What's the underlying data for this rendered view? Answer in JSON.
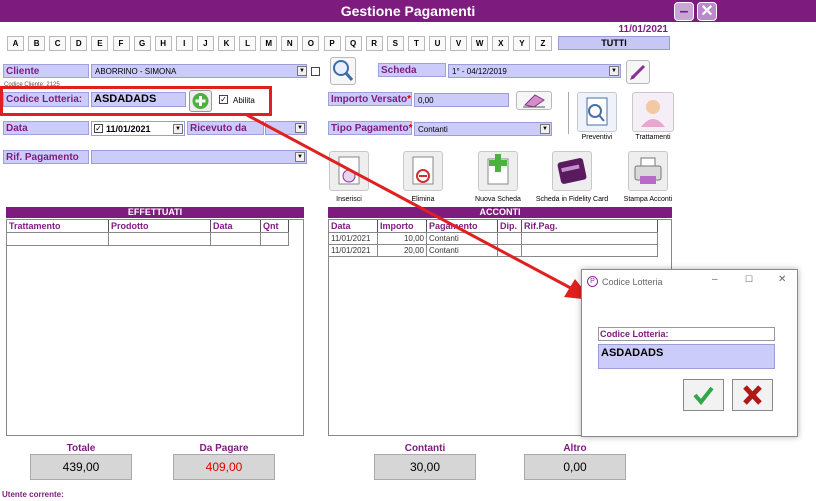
{
  "window": {
    "title": "Gestione Pagamenti",
    "date": "11/01/2021"
  },
  "alphabet": [
    "A",
    "B",
    "C",
    "D",
    "E",
    "F",
    "G",
    "H",
    "I",
    "J",
    "K",
    "L",
    "M",
    "N",
    "O",
    "P",
    "Q",
    "R",
    "S",
    "T",
    "U",
    "V",
    "W",
    "X",
    "Y",
    "Z"
  ],
  "tutti_label": "TUTTI",
  "form": {
    "cliente_label": "Cliente",
    "cliente_value": "ABORRINO - SIMONA",
    "codice_cliente": "Codice Cliente: 2125",
    "scheda_label": "Scheda",
    "scheda_value": "1° - 04/12/2019",
    "lotteria_label": "Codice Lotteria:",
    "lotteria_value": "ASDADADS",
    "abilita_label": "Abilita",
    "importo_label": "Importo Versato",
    "importo_value": "0,00",
    "data_label": "Data",
    "data_value": "11/01/2021",
    "ricevuto_label": "Ricevuto da",
    "tipo_label": "Tipo Pagamento",
    "tipo_value": "Contanti",
    "rif_label": "Rif. Pagamento",
    "required_mark": "*"
  },
  "side_buttons": {
    "preventivi": "Preventivi",
    "trattamenti": "Trattamenti"
  },
  "actions": [
    "Inserisci",
    "Elimina",
    "Nuova Scheda",
    "Scheda in Fidelity Card",
    "Stampa Acconti"
  ],
  "effettuati": {
    "title": "EFFETTUATI",
    "columns": [
      "Trattamento",
      "Prodotto",
      "Data",
      "Qnt"
    ]
  },
  "acconti": {
    "title": "ACCONTI",
    "columns": [
      "Data",
      "Importo",
      "Pagamento",
      "Dip.",
      "Rif.Pag."
    ],
    "rows": [
      [
        "11/01/2021",
        "10,00",
        "Contanti",
        "",
        ""
      ],
      [
        "11/01/2021",
        "20,00",
        "Contanti",
        "",
        ""
      ]
    ]
  },
  "totals": [
    {
      "label": "Totale",
      "value": "439,00"
    },
    {
      "label": "Da Pagare",
      "value": "409,00"
    },
    {
      "label": "Contanti",
      "value": "30,00"
    },
    {
      "label": "Altro",
      "value": "0,00"
    }
  ],
  "utente_label": "Utente corrente:",
  "dialog": {
    "title": "Codice Lotteria",
    "field_label": "Codice Lotteria:",
    "field_value": "ASDADADS"
  },
  "colors": {
    "accent": "#7d1b7e",
    "field": "#ccccfa",
    "annotation": "#e02020",
    "due": "#e00000"
  },
  "icons": [
    "minimize-icon",
    "close-icon",
    "search-icon",
    "edit-icon",
    "add-icon",
    "eraser-icon",
    "checkmark-icon",
    "cross-icon"
  ]
}
